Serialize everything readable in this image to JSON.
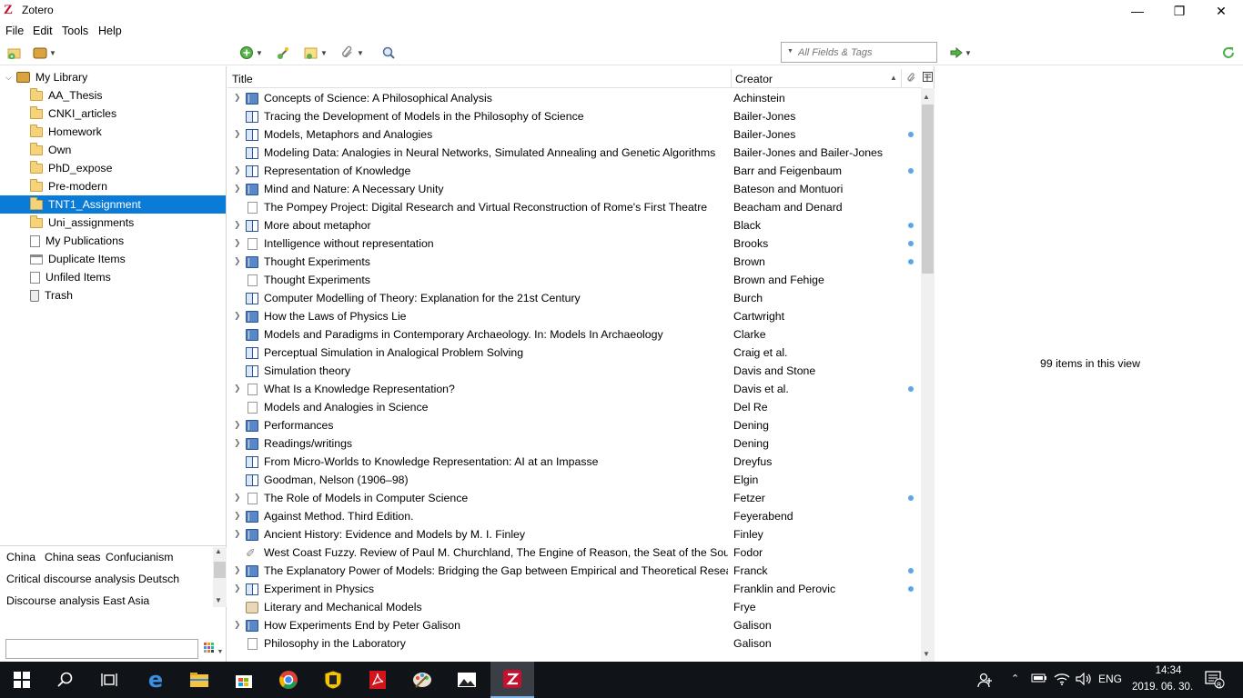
{
  "window": {
    "title": "Zotero",
    "logo": "Z"
  },
  "menu": [
    "File",
    "Edit",
    "Tools",
    "Help"
  ],
  "toolbar": {
    "search_placeholder": "All Fields & Tags"
  },
  "collections": {
    "library_label": "My Library",
    "items": [
      {
        "label": "AA_Thesis",
        "icon": "folder-icon"
      },
      {
        "label": "CNKI_articles",
        "icon": "folder-icon"
      },
      {
        "label": "Homework",
        "icon": "folder-icon"
      },
      {
        "label": "Own",
        "icon": "folder-icon"
      },
      {
        "label": "PhD_expose",
        "icon": "folder-icon"
      },
      {
        "label": "Pre-modern",
        "icon": "folder-icon"
      },
      {
        "label": "TNT1_Assignment",
        "icon": "folder-icon",
        "selected": true
      },
      {
        "label": "Uni_assignments",
        "icon": "folder-icon"
      },
      {
        "label": "My Publications",
        "icon": "publications-icon"
      },
      {
        "label": "Duplicate Items",
        "icon": "duplicate-icon"
      },
      {
        "label": "Unfiled Items",
        "icon": "unfiled-icon"
      },
      {
        "label": "Trash",
        "icon": "trash-icon"
      }
    ]
  },
  "tags": [
    "China",
    "China seas",
    "Confucianism",
    "Critical discourse analysis",
    "Deutsch",
    "Discourse analysis",
    "East Asia"
  ],
  "tag_filter": {
    "value": ""
  },
  "items_table": {
    "columns": [
      "Title",
      "Creator"
    ],
    "rows": [
      {
        "title": "Concepts of Science: A Philosophical Analysis",
        "creator": "Achinstein",
        "type": "book",
        "twisty": true,
        "dot": false
      },
      {
        "title": "Tracing the Development of Models in the Philosophy of Science",
        "creator": "Bailer-Jones",
        "type": "section",
        "twisty": false,
        "dot": false
      },
      {
        "title": "Models, Metaphors and Analogies",
        "creator": "Bailer-Jones",
        "type": "section",
        "twisty": true,
        "dot": true
      },
      {
        "title": "Modeling Data: Analogies in Neural Networks, Simulated Annealing and Genetic Algorithms",
        "creator": "Bailer-Jones and Bailer-Jones",
        "type": "section",
        "twisty": false,
        "dot": false
      },
      {
        "title": "Representation of Knowledge",
        "creator": "Barr and Feigenbaum",
        "type": "section",
        "twisty": true,
        "dot": true
      },
      {
        "title": "Mind and Nature: A Necessary Unity",
        "creator": "Bateson and Montuori",
        "type": "book",
        "twisty": true,
        "dot": false
      },
      {
        "title": "The Pompey Project: Digital Research and Virtual Reconstruction of Rome's First Theatre",
        "creator": "Beacham and Denard",
        "type": "document",
        "twisty": false,
        "dot": false
      },
      {
        "title": "More about metaphor",
        "creator": "Black",
        "type": "section",
        "twisty": true,
        "dot": true
      },
      {
        "title": "Intelligence without representation",
        "creator": "Brooks",
        "type": "document",
        "twisty": true,
        "dot": true
      },
      {
        "title": "Thought Experiments",
        "creator": "Brown",
        "type": "book",
        "twisty": true,
        "dot": true
      },
      {
        "title": "Thought Experiments",
        "creator": "Brown and Fehige",
        "type": "document",
        "twisty": false,
        "dot": false
      },
      {
        "title": "Computer Modelling of Theory: Explanation for the 21st Century",
        "creator": "Burch",
        "type": "section",
        "twisty": false,
        "dot": false
      },
      {
        "title": "How the Laws of Physics Lie",
        "creator": "Cartwright",
        "type": "book",
        "twisty": true,
        "dot": false
      },
      {
        "title": "Models and Paradigms in Contemporary Archaeology. In: Models In Archaeology",
        "creator": "Clarke",
        "type": "book",
        "twisty": false,
        "dot": false
      },
      {
        "title": "Perceptual Simulation in Analogical Problem Solving",
        "creator": "Craig et al.",
        "type": "section",
        "twisty": false,
        "dot": false
      },
      {
        "title": "Simulation theory",
        "creator": "Davis and Stone",
        "type": "section",
        "twisty": false,
        "dot": false
      },
      {
        "title": "What Is a Knowledge Representation?",
        "creator": "Davis et al.",
        "type": "document",
        "twisty": true,
        "dot": true
      },
      {
        "title": "Models and Analogies in Science",
        "creator": "Del Re",
        "type": "document",
        "twisty": false,
        "dot": false
      },
      {
        "title": "Performances",
        "creator": "Dening",
        "type": "book",
        "twisty": true,
        "dot": false
      },
      {
        "title": "Readings/writings",
        "creator": "Dening",
        "type": "book",
        "twisty": true,
        "dot": false
      },
      {
        "title": "From Micro-Worlds to Knowledge Representation: AI at an Impasse",
        "creator": "Dreyfus",
        "type": "section",
        "twisty": false,
        "dot": false
      },
      {
        "title": "Goodman, Nelson (1906–98)",
        "creator": "Elgin",
        "type": "section",
        "twisty": false,
        "dot": false
      },
      {
        "title": "The Role of Models in Computer Science",
        "creator": "Fetzer",
        "type": "document",
        "twisty": true,
        "dot": true
      },
      {
        "title": "Against Method. Third Edition.",
        "creator": "Feyerabend",
        "type": "book",
        "twisty": true,
        "dot": false
      },
      {
        "title": "Ancient History: Evidence and Models by M. I. Finley",
        "creator": "Finley",
        "type": "book",
        "twisty": true,
        "dot": false
      },
      {
        "title": "West Coast Fuzzy. Review of Paul M. Churchland, The Engine of Reason, the Seat of the Soul.",
        "creator": "Fodor",
        "type": "attachment",
        "twisty": false,
        "dot": false
      },
      {
        "title": "The Explanatory Power of Models: Bridging the Gap between Empirical and Theoretical Researc...",
        "creator": "Franck",
        "type": "book",
        "twisty": true,
        "dot": true
      },
      {
        "title": "Experiment in Physics",
        "creator": "Franklin and Perovic",
        "type": "section",
        "twisty": true,
        "dot": true
      },
      {
        "title": "Literary and Mechanical Models",
        "creator": "Frye",
        "type": "art",
        "twisty": false,
        "dot": false
      },
      {
        "title": "How Experiments End by Peter Galison",
        "creator": "Galison",
        "type": "book",
        "twisty": true,
        "dot": false
      },
      {
        "title": "Philosophy in the Laboratory",
        "creator": "Galison",
        "type": "document",
        "twisty": false,
        "dot": false
      }
    ]
  },
  "item_pane": {
    "count_text": "99 items in this view"
  },
  "taskbar": {
    "language": "ENG",
    "time": "14:34",
    "date": "2019. 06. 30.",
    "notifications": "8",
    "colors": {
      "bar": "#101418",
      "active": "#3a3f45"
    }
  },
  "colors": {
    "selection": "#0a7bd6",
    "attachment_dot": "#5aa6e8",
    "brand": "#c8102e"
  }
}
